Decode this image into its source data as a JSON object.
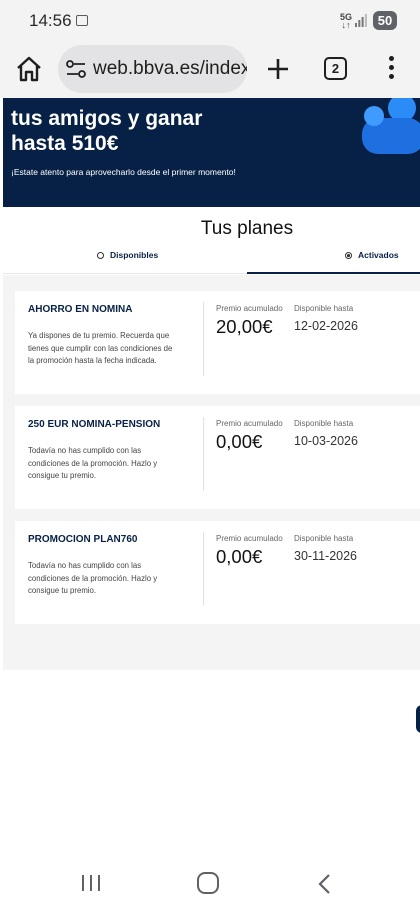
{
  "status_bar": {
    "time": "14:56",
    "network": "5G",
    "battery": "50"
  },
  "browser": {
    "url": "web.bbva.es/index",
    "tab_count": "2"
  },
  "hero": {
    "title": "tus amigos y ganar hasta 510€",
    "subtitle": "¡Estate atento para aprovecharlo desde el primer momento!"
  },
  "plans": {
    "title": "Tus planes",
    "tabs": [
      {
        "label": "Disponibles",
        "selected": false
      },
      {
        "label": "Activados",
        "selected": true
      }
    ],
    "premio_label": "Premio acumulado",
    "hasta_label": "Disponible hasta",
    "cards": [
      {
        "name": "AHORRO EN NOMINA",
        "description": "Ya dispones de tu premio. Recuerda que tienes que cumplir con las condiciones de la promoción hasta la fecha indicada.",
        "amount": "20,00€",
        "date": "12-02-2026"
      },
      {
        "name": "250 EUR NOMINA-PENSION",
        "description": "Todavía no has cumplido con las condiciones de la promoción. Hazlo y consigue tu premio.",
        "amount": "0,00€",
        "date": "10-03-2026"
      },
      {
        "name": "PROMOCION PLAN760",
        "description": "Todavía no has cumplido con las condiciones de la promoción. Hazlo y consigue tu premio.",
        "amount": "0,00€",
        "date": "30-11-2026"
      }
    ]
  },
  "colors": {
    "brand_navy": "#072146",
    "page_gray": "#f4f4f4",
    "illustration_blue": "#1e6fe0"
  }
}
